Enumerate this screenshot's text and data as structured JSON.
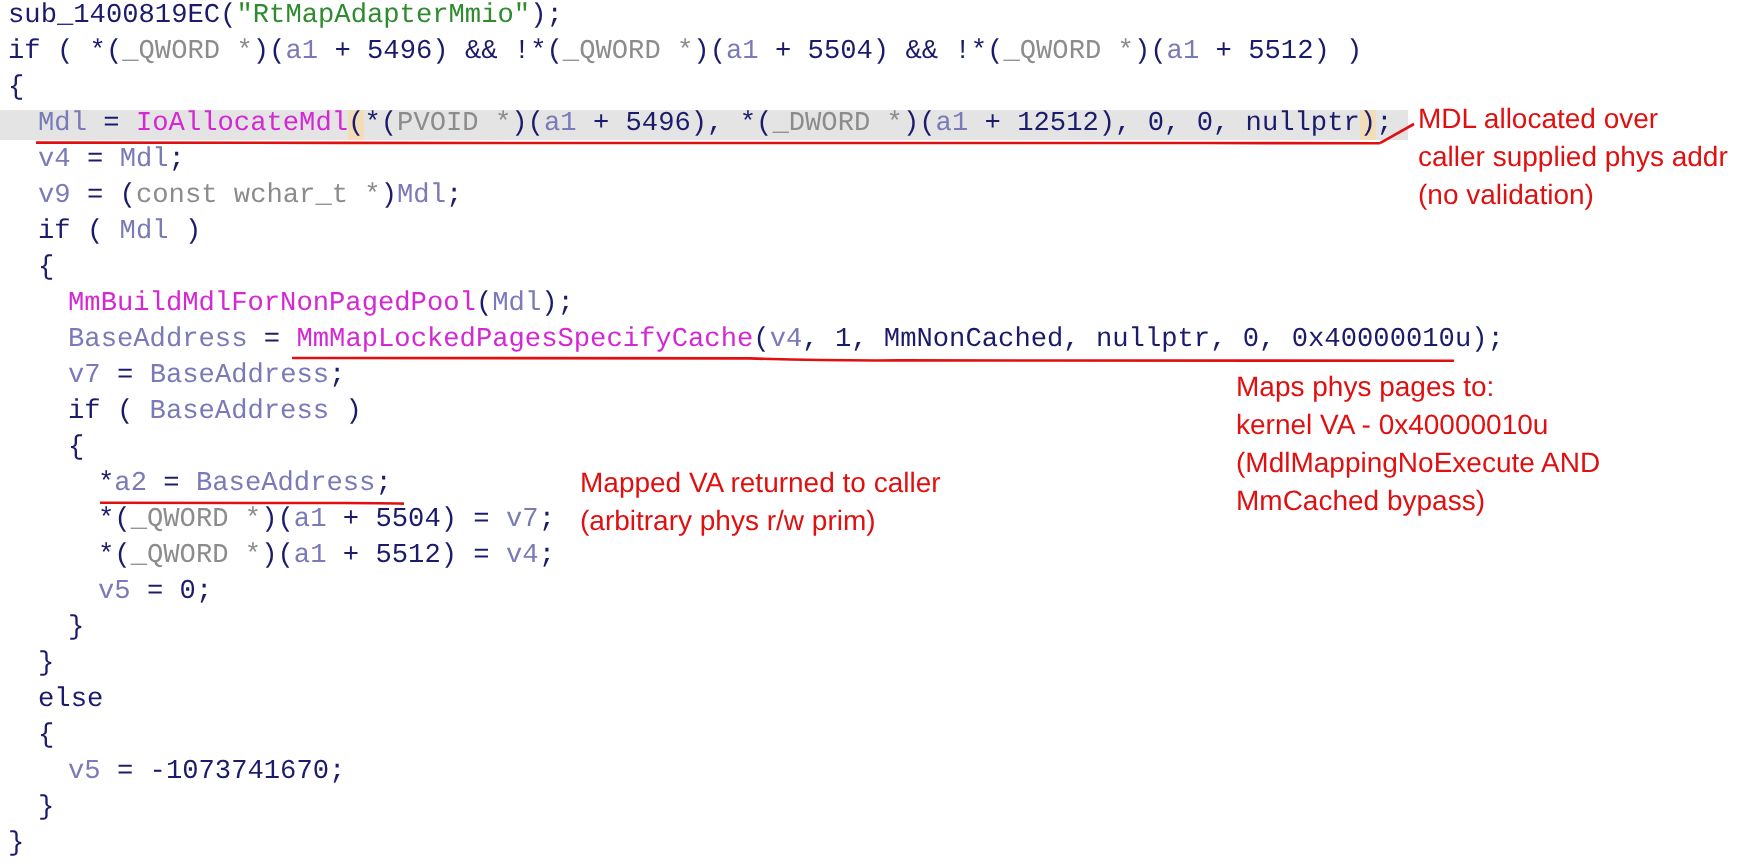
{
  "lines": [
    {
      "selected": false,
      "tokens": [
        {
          "kind": "plain",
          "text": "sub_1400819EC("
        },
        {
          "kind": "string",
          "text": "\"RtMapAdapterMmio\""
        },
        {
          "kind": "plain",
          "text": ");"
        }
      ]
    },
    {
      "selected": false,
      "tokens": [
        {
          "kind": "plain",
          "text": "if ( *("
        },
        {
          "kind": "type",
          "text": "_QWORD *"
        },
        {
          "kind": "plain",
          "text": ")("
        },
        {
          "kind": "var",
          "text": "a1"
        },
        {
          "kind": "plain",
          "text": " + 5496) && !*("
        },
        {
          "kind": "type",
          "text": "_QWORD *"
        },
        {
          "kind": "plain",
          "text": ")("
        },
        {
          "kind": "var",
          "text": "a1"
        },
        {
          "kind": "plain",
          "text": " + 5504) && !*("
        },
        {
          "kind": "type",
          "text": "_QWORD *"
        },
        {
          "kind": "plain",
          "text": ")("
        },
        {
          "kind": "var",
          "text": "a1"
        },
        {
          "kind": "plain",
          "text": " + 5512) )"
        }
      ]
    },
    {
      "selected": false,
      "tokens": [
        {
          "kind": "plain",
          "text": "{"
        }
      ],
      "children": [
        {
          "selected": true,
          "tokens": [
            {
              "kind": "var",
              "text": "Mdl"
            },
            {
              "kind": "plain",
              "text": " = "
            },
            {
              "kind": "func",
              "text": "IoAllocateMdl"
            },
            {
              "kind": "match",
              "text": "("
            },
            {
              "kind": "plain",
              "text": "*("
            },
            {
              "kind": "type",
              "text": "PVOID *"
            },
            {
              "kind": "plain",
              "text": ")("
            },
            {
              "kind": "var",
              "text": "a1"
            },
            {
              "kind": "plain",
              "text": " + 5496), *("
            },
            {
              "kind": "type",
              "text": "_DWORD *"
            },
            {
              "kind": "plain",
              "text": ")("
            },
            {
              "kind": "var",
              "text": "a1"
            },
            {
              "kind": "plain",
              "text": " + 12512), 0, 0, nullptr"
            },
            {
              "kind": "match",
              "text": ")"
            },
            {
              "kind": "plain",
              "text": ";"
            }
          ]
        },
        {
          "selected": false,
          "tokens": [
            {
              "kind": "var",
              "text": "v4"
            },
            {
              "kind": "plain",
              "text": " = "
            },
            {
              "kind": "var",
              "text": "Mdl"
            },
            {
              "kind": "plain",
              "text": ";"
            }
          ]
        },
        {
          "selected": false,
          "tokens": [
            {
              "kind": "var",
              "text": "v9"
            },
            {
              "kind": "plain",
              "text": " = ("
            },
            {
              "kind": "type",
              "text": "const wchar_t *"
            },
            {
              "kind": "plain",
              "text": ")"
            },
            {
              "kind": "var",
              "text": "Mdl"
            },
            {
              "kind": "plain",
              "text": ";"
            }
          ]
        },
        {
          "selected": false,
          "tokens": [
            {
              "kind": "plain",
              "text": "if ( "
            },
            {
              "kind": "var",
              "text": "Mdl"
            },
            {
              "kind": "plain",
              "text": " )"
            }
          ]
        },
        {
          "selected": false,
          "tokens": [
            {
              "kind": "plain",
              "text": "{"
            }
          ],
          "children": [
            {
              "selected": false,
              "tokens": [
                {
                  "kind": "func",
                  "text": "MmBuildMdlForNonPagedPool"
                },
                {
                  "kind": "plain",
                  "text": "("
                },
                {
                  "kind": "var",
                  "text": "Mdl"
                },
                {
                  "kind": "plain",
                  "text": ");"
                }
              ]
            },
            {
              "selected": false,
              "tokens": [
                {
                  "kind": "var",
                  "text": "BaseAddress"
                },
                {
                  "kind": "plain",
                  "text": " = "
                },
                {
                  "kind": "func",
                  "text": "MmMapLockedPagesSpecifyCache"
                },
                {
                  "kind": "plain",
                  "text": "("
                },
                {
                  "kind": "var",
                  "text": "v4"
                },
                {
                  "kind": "plain",
                  "text": ", 1, MmNonCached, nullptr, 0, 0x40000010u);"
                }
              ]
            },
            {
              "selected": false,
              "tokens": [
                {
                  "kind": "var",
                  "text": "v7"
                },
                {
                  "kind": "plain",
                  "text": " = "
                },
                {
                  "kind": "var",
                  "text": "BaseAddress"
                },
                {
                  "kind": "plain",
                  "text": ";"
                }
              ]
            },
            {
              "selected": false,
              "tokens": [
                {
                  "kind": "plain",
                  "text": "if ( "
                },
                {
                  "kind": "var",
                  "text": "BaseAddress"
                },
                {
                  "kind": "plain",
                  "text": " )"
                }
              ]
            },
            {
              "selected": false,
              "tokens": [
                {
                  "kind": "plain",
                  "text": "{"
                }
              ],
              "children": [
                {
                  "selected": false,
                  "tokens": [
                    {
                      "kind": "plain",
                      "text": "*"
                    },
                    {
                      "kind": "var",
                      "text": "a2"
                    },
                    {
                      "kind": "plain",
                      "text": " = "
                    },
                    {
                      "kind": "var",
                      "text": "BaseAddress"
                    },
                    {
                      "kind": "plain",
                      "text": ";"
                    }
                  ]
                },
                {
                  "selected": false,
                  "tokens": [
                    {
                      "kind": "plain",
                      "text": "*("
                    },
                    {
                      "kind": "type",
                      "text": "_QWORD *"
                    },
                    {
                      "kind": "plain",
                      "text": ")("
                    },
                    {
                      "kind": "var",
                      "text": "a1"
                    },
                    {
                      "kind": "plain",
                      "text": " + 5504) = "
                    },
                    {
                      "kind": "var",
                      "text": "v7"
                    },
                    {
                      "kind": "plain",
                      "text": ";"
                    }
                  ]
                },
                {
                  "selected": false,
                  "tokens": [
                    {
                      "kind": "plain",
                      "text": "*("
                    },
                    {
                      "kind": "type",
                      "text": "_QWORD *"
                    },
                    {
                      "kind": "plain",
                      "text": ")("
                    },
                    {
                      "kind": "var",
                      "text": "a1"
                    },
                    {
                      "kind": "plain",
                      "text": " + 5512) = "
                    },
                    {
                      "kind": "var",
                      "text": "v4"
                    },
                    {
                      "kind": "plain",
                      "text": ";"
                    }
                  ]
                },
                {
                  "selected": false,
                  "tokens": [
                    {
                      "kind": "var",
                      "text": "v5"
                    },
                    {
                      "kind": "plain",
                      "text": " = 0;"
                    }
                  ]
                }
              ]
            },
            {
              "selected": false,
              "tokens": [
                {
                  "kind": "plain",
                  "text": "}"
                }
              ]
            }
          ]
        },
        {
          "selected": false,
          "tokens": [
            {
              "kind": "plain",
              "text": "}"
            }
          ]
        },
        {
          "selected": false,
          "tokens": [
            {
              "kind": "plain",
              "text": "else"
            }
          ]
        },
        {
          "selected": false,
          "tokens": [
            {
              "kind": "plain",
              "text": "{"
            }
          ],
          "children": [
            {
              "selected": false,
              "tokens": [
                {
                  "kind": "var",
                  "text": "v5"
                },
                {
                  "kind": "plain",
                  "text": " = -1073741670;"
                }
              ]
            }
          ]
        },
        {
          "selected": false,
          "tokens": [
            {
              "kind": "plain",
              "text": "}"
            }
          ]
        }
      ]
    },
    {
      "selected": false,
      "tokens": [
        {
          "kind": "plain",
          "text": "}"
        }
      ]
    }
  ],
  "annotations": [
    {
      "lines": [
        "MDL allocated over",
        "caller supplied phys addr",
        "(no validation)"
      ]
    },
    {
      "lines": [
        "Maps phys pages to:",
        "kernel VA - 0x40000010u",
        "(MdlMappingNoExecute AND",
        "MmCached bypass)"
      ]
    },
    {
      "lines": [
        "Mapped VA returned to caller",
        "(arbitrary phys r/w prim)"
      ]
    }
  ]
}
